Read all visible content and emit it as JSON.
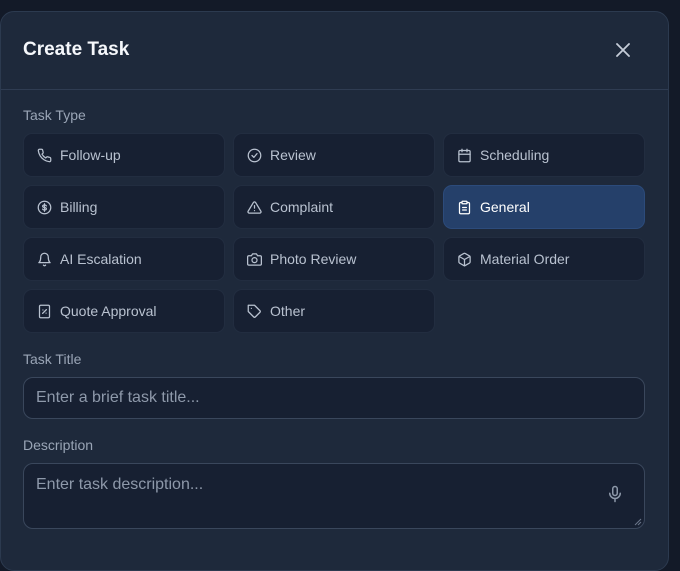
{
  "modal": {
    "title": "Create Task"
  },
  "task_type": {
    "label": "Task Type",
    "selected": "General",
    "options": [
      {
        "label": "Follow-up",
        "icon": "phone-icon"
      },
      {
        "label": "Review",
        "icon": "check-circle-icon"
      },
      {
        "label": "Scheduling",
        "icon": "calendar-icon"
      },
      {
        "label": "Billing",
        "icon": "dollar-circle-icon"
      },
      {
        "label": "Complaint",
        "icon": "warning-triangle-icon"
      },
      {
        "label": "General",
        "icon": "clipboard-icon"
      },
      {
        "label": "AI Escalation",
        "icon": "bell-icon"
      },
      {
        "label": "Photo Review",
        "icon": "camera-icon"
      },
      {
        "label": "Material Order",
        "icon": "package-icon"
      },
      {
        "label": "Quote Approval",
        "icon": "receipt-icon"
      },
      {
        "label": "Other",
        "icon": "tag-icon"
      }
    ]
  },
  "task_title": {
    "label": "Task Title",
    "placeholder": "Enter a brief task title..."
  },
  "description": {
    "label": "Description",
    "placeholder": "Enter task description..."
  },
  "colors": {
    "background": "#1e293b",
    "button": "#172032",
    "selected": "#25406a"
  }
}
